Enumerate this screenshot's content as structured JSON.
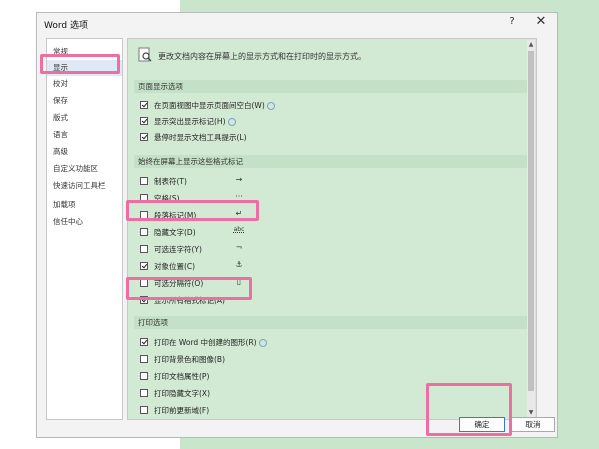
{
  "dialog": {
    "title": "Word 选项",
    "help_label": "?",
    "close_label": "✕"
  },
  "sidebar": {
    "items": [
      {
        "label": "常规"
      },
      {
        "label": "显示"
      },
      {
        "label": "校对"
      },
      {
        "label": "保存"
      },
      {
        "label": "版式"
      },
      {
        "label": "语言"
      },
      {
        "label": "高级"
      },
      {
        "label": "自定义功能区"
      },
      {
        "label": "快速访问工具栏"
      },
      {
        "label": "加载项"
      },
      {
        "label": "信任中心"
      }
    ],
    "active_index": 1
  },
  "content": {
    "intro": "更改文档内容在屏幕上的显示方式和在打印时的显示方式。",
    "section_page": {
      "header": "页面显示选项",
      "options": [
        {
          "label": "在页面视图中显示页面间空白(W)",
          "checked": true
        },
        {
          "label": "显示突出显示标记(H)",
          "checked": true
        },
        {
          "label": "悬停时显示文档工具提示(L)",
          "checked": true
        }
      ]
    },
    "section_marks": {
      "header": "始终在屏幕上显示这些格式标记",
      "options": [
        {
          "label": "制表符(T)",
          "checked": false,
          "glyph": "→"
        },
        {
          "label": "空格(S)",
          "checked": false,
          "glyph": "···"
        },
        {
          "label": "段落标记(M)",
          "checked": false,
          "glyph": "↵"
        },
        {
          "label": "隐藏文字(D)",
          "checked": false,
          "glyph": "abc"
        },
        {
          "label": "可选连字符(Y)",
          "checked": false,
          "glyph": "¬"
        },
        {
          "label": "对象位置(C)",
          "checked": true,
          "glyph": "⚓"
        },
        {
          "label": "可选分隔符(O)",
          "checked": false,
          "glyph": "▯"
        },
        {
          "label": "显示所有格式标记(A)",
          "checked": true,
          "glyph": ""
        }
      ]
    },
    "section_print": {
      "header": "打印选项",
      "options": [
        {
          "label": "打印在 Word 中创建的图形(R)",
          "checked": true
        },
        {
          "label": "打印背景色和图像(B)",
          "checked": false
        },
        {
          "label": "打印文档属性(P)",
          "checked": false
        },
        {
          "label": "打印隐藏文字(X)",
          "checked": false
        },
        {
          "label": "打印前更新域(F)",
          "checked": false
        }
      ]
    }
  },
  "footer": {
    "ok_label": "确定",
    "cancel_label": "取消"
  },
  "colors": {
    "highlight": "#ec6ea2",
    "panel_green": "#d2ead3",
    "checkbox_border": "#555555"
  }
}
